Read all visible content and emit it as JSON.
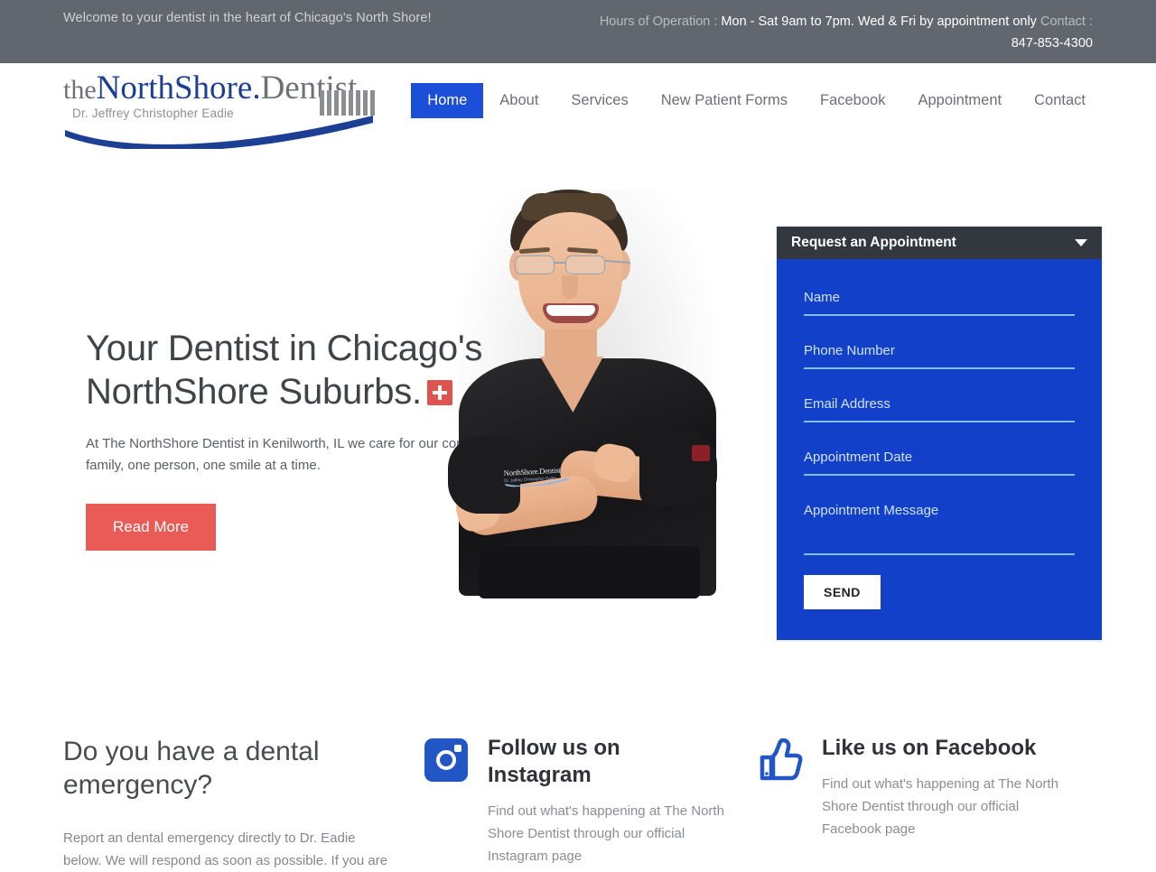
{
  "topbar": {
    "welcome": "Welcome to your dentist in the heart of Chicago's North Shore!",
    "hours_label": "Hours of Operation :",
    "hours_value": "Mon - Sat 9am to 7pm. Wed & Fri by appointment only",
    "contact_label": "Contact :",
    "phone": "847-853-4300",
    "bg_color": "#62666e"
  },
  "logo": {
    "the": "the",
    "northshore": "NorthShore",
    "dot": ".",
    "dentist": "Dentist",
    "subtitle": "Dr. Jeffrey Christopher Eadie",
    "blue": "#1c3f94",
    "gray": "#6e7277"
  },
  "nav": {
    "items": [
      {
        "label": "Home",
        "active": true
      },
      {
        "label": "About",
        "active": false
      },
      {
        "label": "Services",
        "active": false
      },
      {
        "label": "New Patient Forms",
        "active": false
      },
      {
        "label": "Facebook",
        "active": false
      },
      {
        "label": "Appointment",
        "active": false
      },
      {
        "label": "Contact",
        "active": false
      }
    ],
    "active_bg": "#1c4fd8"
  },
  "hero": {
    "title_line1": "Your Dentist in Chicago's",
    "title_line2": "NorthShore Suburbs.",
    "badge_icon": "medical-cross-icon",
    "badge_color": "#e0544f",
    "subtitle": "At The NorthShore Dentist in Kenilworth, IL we care for our community, one family, one person, one smile at a time.",
    "read_more": "Read More",
    "read_more_color": "#ea5b58",
    "photo_alt": "Dr. Jeffrey Christopher Eadie in black scrubs with arms crossed",
    "shirt_logo_text": "NorthShore.Dentist",
    "shirt_logo_sub": "Dr. Jeffrey Christopher Eadie"
  },
  "appointment": {
    "header": "Request an Appointment",
    "header_bg": "#33373e",
    "body_bg": "#1340c8",
    "chevron_icon": "chevron-down-icon",
    "fields": [
      {
        "name": "name",
        "placeholder": "Name",
        "value": ""
      },
      {
        "name": "phone",
        "placeholder": "Phone Number",
        "value": ""
      },
      {
        "name": "email",
        "placeholder": "Email Address",
        "value": ""
      },
      {
        "name": "date",
        "placeholder": "Appointment Date",
        "value": ""
      },
      {
        "name": "message",
        "placeholder": "Appointment Message",
        "value": ""
      }
    ],
    "send_label": "SEND"
  },
  "bottom": {
    "emergency": {
      "title": "Do you have a dental emergency?",
      "text": "Report an dental emergency directly to Dr. Eadie below. We will respond as soon as possible. If you are"
    },
    "instagram": {
      "icon": "instagram-icon",
      "icon_color": "#2256c4",
      "heading": "Follow us on Instagram",
      "text": "Find out what's happening at The North Shore Dentist through our official Instagram page"
    },
    "facebook": {
      "icon": "facebook-thumbs-up-icon",
      "icon_color": "#2256c4",
      "heading": "Like us on Facebook",
      "text": "Find out what's happening at The North Shore Dentist through our official Facebook page"
    }
  }
}
